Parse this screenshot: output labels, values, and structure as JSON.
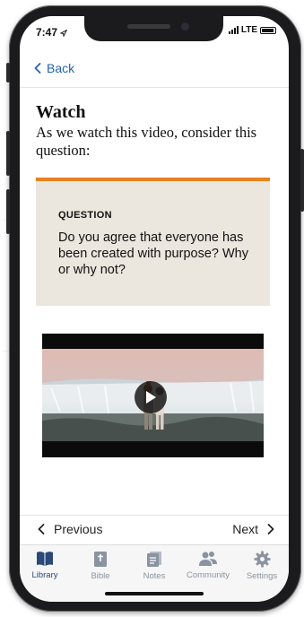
{
  "status": {
    "time": "7:47",
    "network": "LTE"
  },
  "nav": {
    "back_label": "Back"
  },
  "content": {
    "title": "Watch",
    "subtitle": "As we watch this video, consider this question:",
    "question_label": "QUESTION",
    "question_text": "Do you agree that everyone has been created with purpose? Why or why not?"
  },
  "pager": {
    "previous_label": "Previous",
    "next_label": "Next"
  },
  "tabs": [
    {
      "label": "Library",
      "icon": "book-icon"
    },
    {
      "label": "Bible",
      "icon": "bible-icon"
    },
    {
      "label": "Notes",
      "icon": "notes-icon"
    },
    {
      "label": "Community",
      "icon": "people-icon"
    },
    {
      "label": "Settings",
      "icon": "gear-icon"
    }
  ],
  "colors": {
    "accent": "#1f63b6",
    "question_border": "#e8821e",
    "question_bg": "#ebe7de",
    "tab_active": "#2a4a79",
    "tab_inactive": "#8a93a0"
  }
}
